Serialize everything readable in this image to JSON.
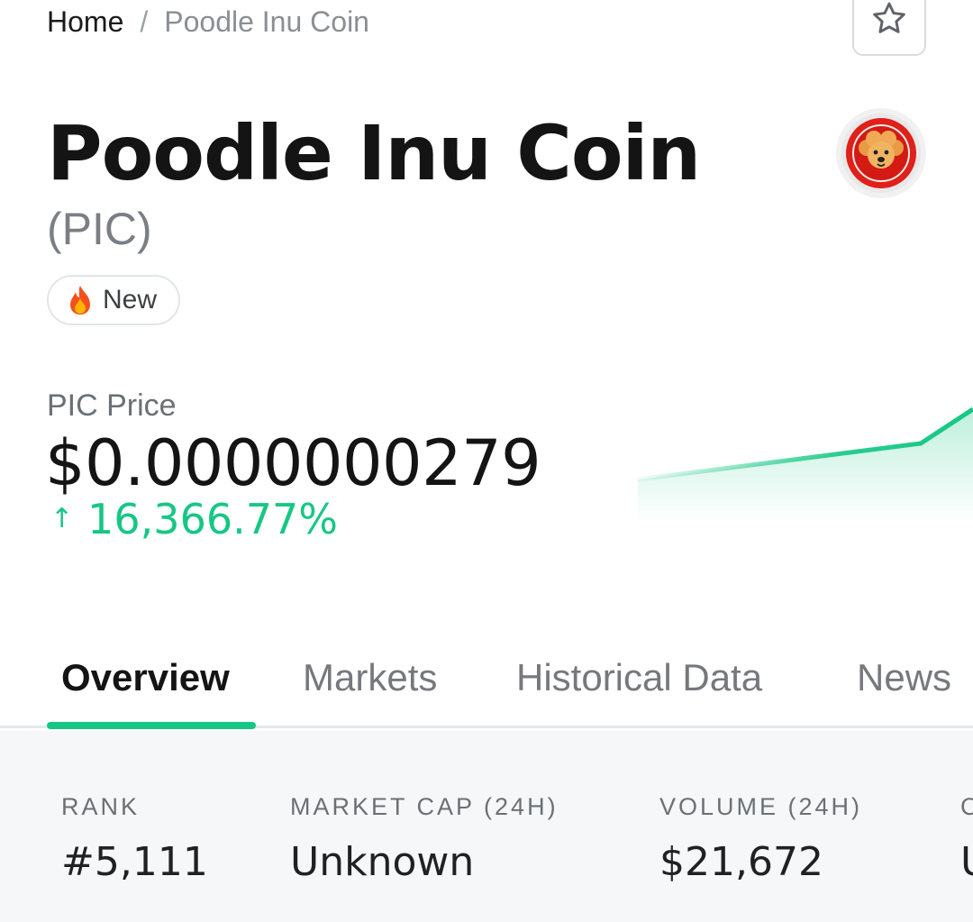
{
  "breadcrumb": {
    "home": "Home",
    "separator": "/",
    "current": "Poodle Inu Coin"
  },
  "coin": {
    "name": "Poodle Inu Coin",
    "symbol": "(PIC)",
    "badge": "New",
    "badge_icon": "fire-icon",
    "logo_icon": "poodle-logo-icon"
  },
  "price": {
    "label": "PIC Price",
    "value": "$0.0000000279",
    "change": "16,366.77%",
    "change_arrow": "↑",
    "change_color": "#16c784"
  },
  "tabs": [
    {
      "label": "Overview",
      "active": true
    },
    {
      "label": "Markets",
      "active": false
    },
    {
      "label": "Historical Data",
      "active": false
    },
    {
      "label": "News",
      "active": false
    }
  ],
  "stats": [
    {
      "label": "RANK",
      "value": "#5,111"
    },
    {
      "label": "MARKET CAP (24H)",
      "value": "Unknown"
    },
    {
      "label": "VOLUME (24H)",
      "value": "$21,672"
    },
    {
      "label": "C",
      "value": "U"
    }
  ],
  "colors": {
    "accent": "#16c784",
    "text": "#141414",
    "muted": "#7a7f85",
    "logo_red": "#e0201a"
  }
}
